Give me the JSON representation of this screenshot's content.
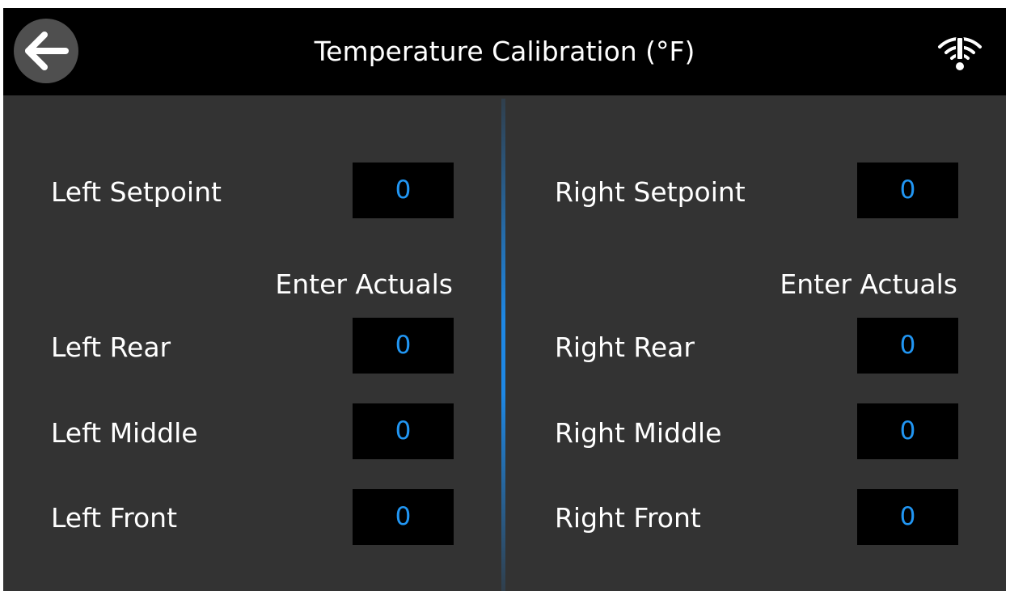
{
  "header": {
    "title": "Temperature Calibration (°F)",
    "back_icon": "arrow-left-icon",
    "status_icon": "wifi-warning-icon"
  },
  "colors": {
    "background": "#333333",
    "header": "#000000",
    "accent": "#2196f3",
    "text": "#ffffff"
  },
  "left": {
    "setpoint": {
      "label": "Left Setpoint",
      "value": "0"
    },
    "actuals_label": "Enter Actuals",
    "rear": {
      "label": "Left Rear",
      "value": "0"
    },
    "middle": {
      "label": "Left Middle",
      "value": "0"
    },
    "front": {
      "label": "Left Front",
      "value": "0"
    }
  },
  "right": {
    "setpoint": {
      "label": "Right Setpoint",
      "value": "0"
    },
    "actuals_label": "Enter Actuals",
    "rear": {
      "label": "Right Rear",
      "value": "0"
    },
    "middle": {
      "label": "Right Middle",
      "value": "0"
    },
    "front": {
      "label": "Right Front",
      "value": "0"
    }
  }
}
